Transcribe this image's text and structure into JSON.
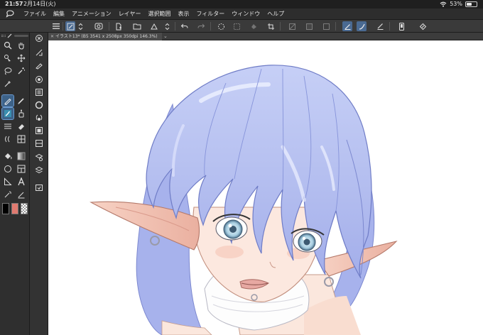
{
  "status_bar": {
    "time": "21:57",
    "date": "2月14日(火)",
    "battery": "53%",
    "battery_level": 0.53
  },
  "menu": {
    "items": [
      "ファイル",
      "編集",
      "アニメーション",
      "レイヤー",
      "選択範囲",
      "表示",
      "フィルター",
      "ウィンドウ",
      "ヘルプ"
    ]
  },
  "toolbar": {
    "active_tool": "brush-size-tool"
  },
  "document": {
    "tab_label": "イラスト13* (B5 3541 x 2508px 350dpi 146.3%)"
  },
  "colors": {
    "main_color": "#000000",
    "sub_color": "#e07a70",
    "transparent": "checker",
    "hair": "#b9c3f2",
    "hair_shadow": "#8e9ae0",
    "skin": "#fbe6dc",
    "accent": "#4a6a92"
  }
}
